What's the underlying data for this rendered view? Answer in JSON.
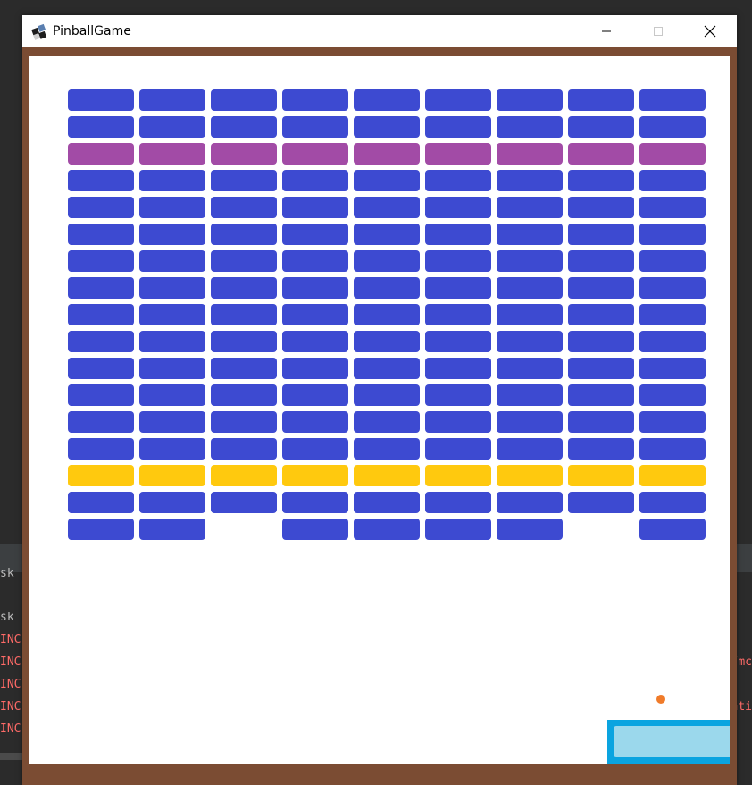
{
  "window": {
    "title": "PinballGame",
    "minimize_glyph": "─",
    "maximize_glyph": "☐",
    "close_glyph": "✕",
    "icon": "pinball-app-icon"
  },
  "background_console": {
    "left_lines": [
      "sk",
      "",
      "sk",
      "INC",
      "INC",
      "INC",
      "INC",
      "INC"
    ],
    "right_lines": [
      "/mc",
      "ati"
    ]
  },
  "game": {
    "grid": {
      "columns": 9,
      "rows": 17,
      "row_colors": [
        "blue",
        "blue",
        "purple",
        "blue",
        "blue",
        "blue",
        "blue",
        "blue",
        "blue",
        "blue",
        "blue",
        "blue",
        "blue",
        "blue",
        "yellow",
        "blue",
        "blue"
      ],
      "missing": [
        [
          16,
          2
        ],
        [
          16,
          7
        ]
      ]
    },
    "colors": {
      "blue": "#3d4ad1",
      "purple": "#a24ba6",
      "yellow": "#ffc90e",
      "ball": "#f07b2a",
      "paddle_border": "#0aa4e0",
      "paddle_fill": "#9bd8ec",
      "frame": "#7b4c33"
    }
  }
}
